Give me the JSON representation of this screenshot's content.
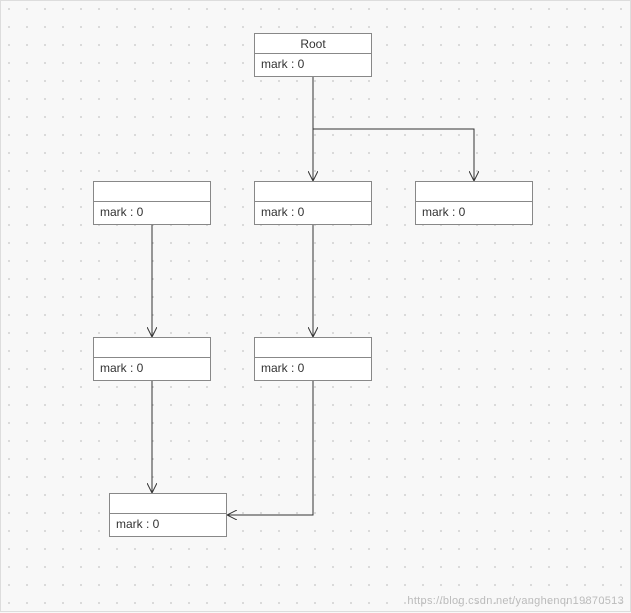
{
  "diagram": {
    "root": {
      "title": "Root",
      "label": "mark : 0"
    },
    "n_left1": {
      "title": "",
      "label": "mark : 0"
    },
    "n_center1": {
      "title": "",
      "label": "mark : 0"
    },
    "n_right1": {
      "title": "",
      "label": "mark : 0"
    },
    "n_left2": {
      "title": "",
      "label": "mark : 0"
    },
    "n_center2": {
      "title": "",
      "label": "mark : 0"
    },
    "n_bottom": {
      "title": "",
      "label": "mark : 0"
    }
  },
  "watermark": "https://blog.csdn.net/yanghenqn19870513"
}
